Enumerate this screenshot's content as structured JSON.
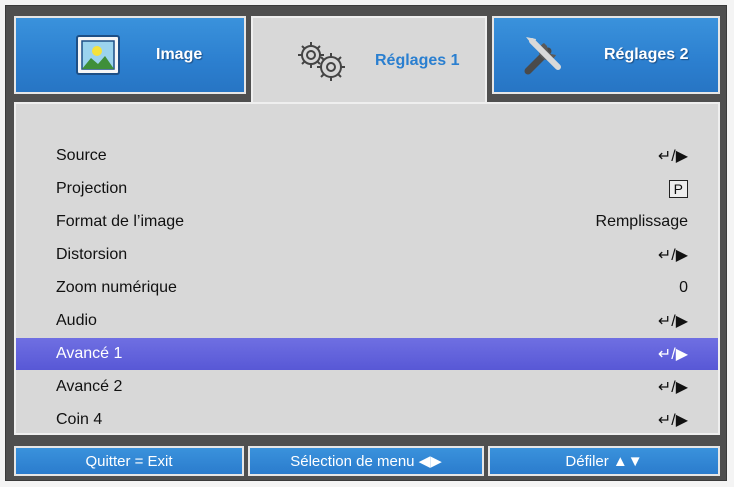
{
  "tabs": [
    {
      "label": "Image",
      "icon": "image-icon"
    },
    {
      "label": "Réglages 1",
      "icon": "gears-icon"
    },
    {
      "label": "Réglages 2",
      "icon": "tools-icon"
    }
  ],
  "menu": [
    {
      "label": "Source",
      "value": "↵/▶"
    },
    {
      "label": "Projection",
      "value": "P"
    },
    {
      "label": "Format de l’image",
      "value": "Remplissage"
    },
    {
      "label": "Distorsion",
      "value": "↵/▶"
    },
    {
      "label": "Zoom numérique",
      "value": "0"
    },
    {
      "label": "Audio",
      "value": "↵/▶"
    },
    {
      "label": "Avancé 1",
      "value": "↵/▶"
    },
    {
      "label": "Avancé 2",
      "value": "↵/▶"
    },
    {
      "label": "Coin 4",
      "value": "↵/▶"
    }
  ],
  "footer": {
    "exit": "Quitter = Exit",
    "select": "Sélection de menu ◀▶",
    "scroll": "Défiler ▲▼"
  },
  "colors": {
    "accent_blue": "#2c7fcf",
    "selected_row": "#5c5cd8",
    "panel": "#d8d8d8",
    "frame": "#4f4f4f"
  }
}
